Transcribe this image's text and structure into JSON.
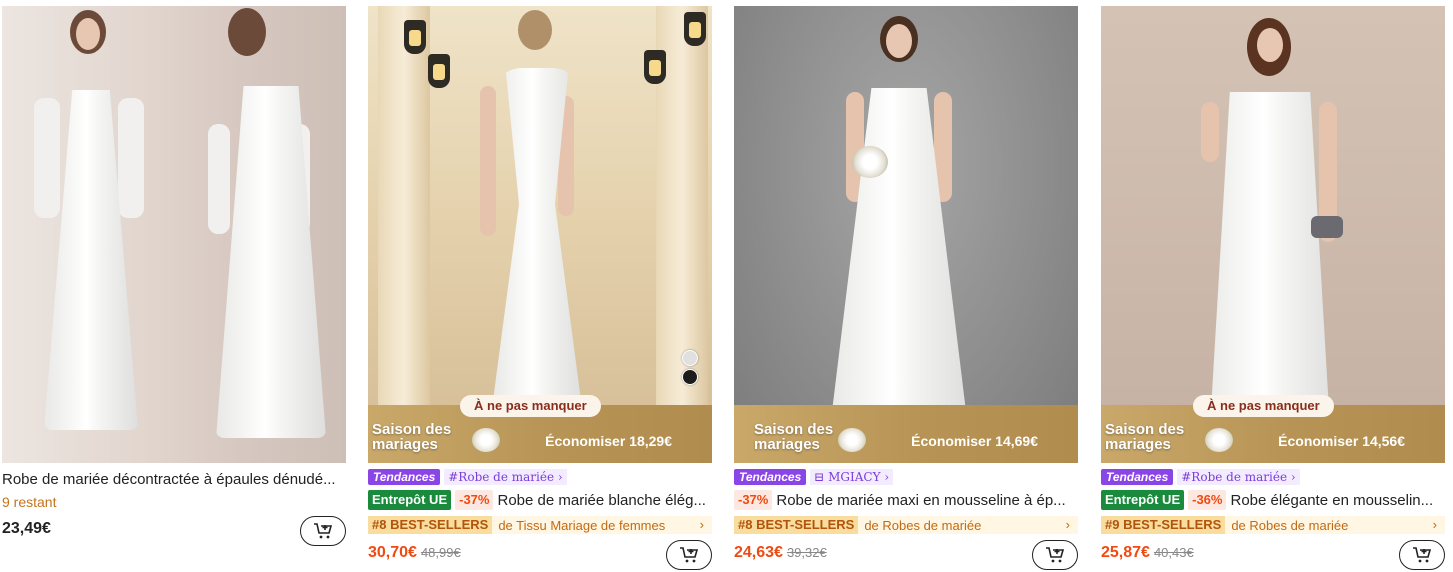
{
  "products": [
    {
      "title": "Robe de mariée décontractée à épaules dénudé...",
      "stock": "9 restant",
      "price": "23,49€"
    },
    {
      "trend_tag": "Tendances",
      "hashtag": "#Robe de mariée ›",
      "banner_tag": "À ne pas manquer",
      "banner_title": "Saison des mariages",
      "banner_save": "Économiser 18,29€",
      "warehouse": "Entrepôt UE",
      "discount": "-37%",
      "title": "Robe de mariée blanche élég...",
      "best_rank": "#8 BEST-SELLERS",
      "best_category": "de Tissu Mariage de femmes",
      "price": "30,70€",
      "old_price": "48,99€",
      "swatches": [
        "#e0e0e0",
        "#1c1c1c"
      ]
    },
    {
      "trend_tag": "Tendances",
      "hashtag": "MGIACY ›",
      "banner_title": "Saison des mariages",
      "banner_save": "Économiser 14,69€",
      "discount": "-37%",
      "title": "Robe de mariée maxi en mousseline à ép...",
      "best_rank": "#8 BEST-SELLERS",
      "best_category": "de Robes de mariée",
      "price": "24,63€",
      "old_price": "39,32€"
    },
    {
      "trend_tag": "Tendances",
      "hashtag": "#Robe de mariée ›",
      "banner_tag": "À ne pas manquer",
      "banner_title": "Saison des mariages",
      "banner_save": "Économiser 14,56€",
      "warehouse": "Entrepôt UE",
      "discount": "-36%",
      "title": "Robe élégante en mousselin...",
      "best_rank": "#9 BEST-SELLERS",
      "best_category": "de Robes de mariée",
      "price": "25,87€",
      "old_price": "40,43€"
    }
  ],
  "chevron": "›",
  "icons": {
    "cart": "add-to-cart-icon"
  },
  "colors": {
    "sale_price": "#f04a11",
    "trend_purple": "#8a45e6",
    "eu_green": "#1a8a3c",
    "stock_orange": "#c4741c"
  }
}
